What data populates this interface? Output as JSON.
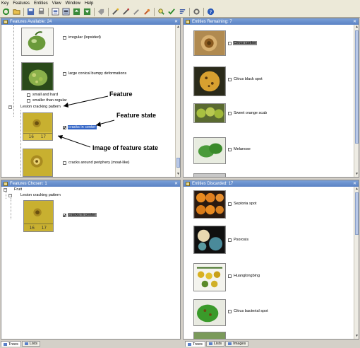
{
  "menu": [
    "Key",
    "Features",
    "Entities",
    "View",
    "Window",
    "Help"
  ],
  "toolbar": [
    "refresh-icon",
    "open-icon",
    "save-icon",
    "print-icon",
    "tree-view-icon",
    "list-view-icon",
    "collapse-icon",
    "expand-icon",
    "tag-icon",
    "wand-icon",
    "wand-alt-icon",
    "wand-clear-icon",
    "pin-icon",
    "find-icon",
    "check-icon",
    "sort-icon",
    "tools-icon",
    "help-icon"
  ],
  "panels": {
    "available": {
      "title": "Features Available: 24",
      "items": {
        "irregular": "irregular (lopsided)",
        "conical": "large conical bumpy deformations",
        "small_hard": "small and hard",
        "smaller": "smaller than regular",
        "lesion": "Lesion cracking pattern",
        "cracks_center": "cracks in center",
        "cracks_periphery": "cracks around periphery (moat-like)"
      }
    },
    "remaining": {
      "title": "Entities Remaining: 7",
      "items": [
        "Citrus canker",
        "Citrus black spot",
        "Sweet orange scab",
        "Melanose"
      ]
    },
    "chosen": {
      "title": "Features Chosen: 1",
      "fruit": "Fruit",
      "lesion": "Lesion cracking pattern",
      "cracks_center": "cracks in center"
    },
    "discarded": {
      "title": "Entities Discarded: 17",
      "items": [
        "Septoria spot",
        "Psorosis",
        "Huanglongbing",
        "Citrus bacterial spot"
      ]
    }
  },
  "annotations": {
    "feature": "Feature",
    "feature_state": "Feature state",
    "image_state": "Image of feature state"
  },
  "tabs_left": [
    "Trees",
    "Lists"
  ],
  "tabs_right": [
    "Trees",
    "Lists",
    "Images"
  ]
}
